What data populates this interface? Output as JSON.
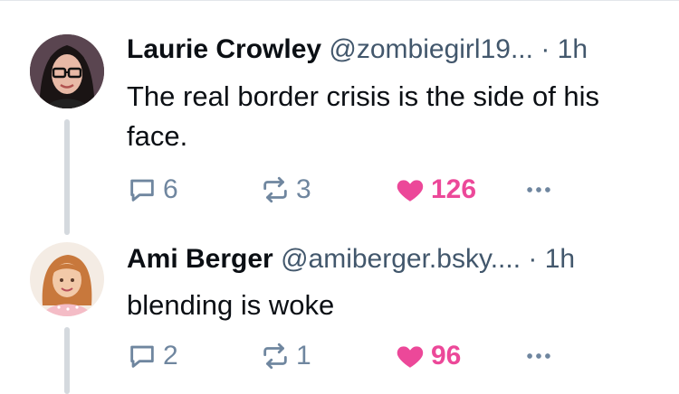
{
  "posts": [
    {
      "author": "Laurie Crowley",
      "handle": "@zombiegirl19...",
      "separator": "·",
      "time": "1h",
      "text": "The real border crisis is the side of his face.",
      "replies": "6",
      "reposts": "3",
      "likes": "126",
      "liked": true,
      "avatar_icon": "woman-with-glasses-avatar"
    },
    {
      "author": "Ami Berger",
      "handle": "@amiberger.bsky....",
      "separator": "·",
      "time": "1h",
      "text": "blending is woke",
      "replies": "2",
      "reposts": "1",
      "likes": "96",
      "liked": true,
      "avatar_icon": "cartoon-woman-avatar"
    }
  ],
  "colors": {
    "like": "#ec4899",
    "action": "#6f869f",
    "handle": "#42576c",
    "thread_line": "#d4d9de"
  }
}
